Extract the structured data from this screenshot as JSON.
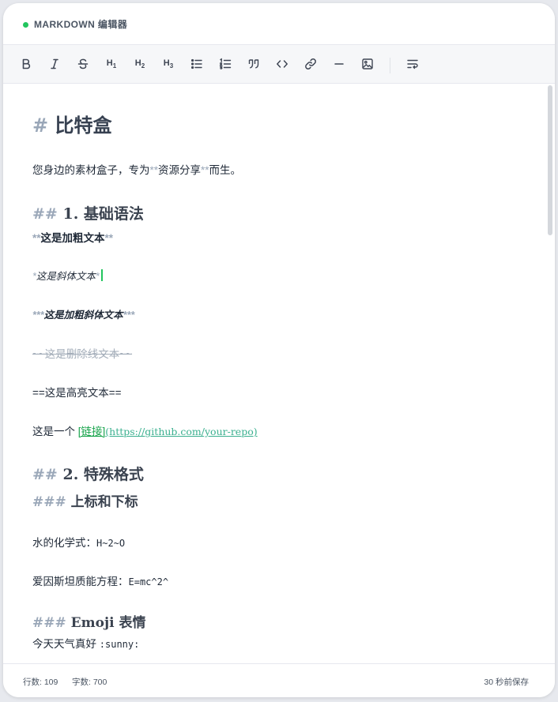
{
  "header": {
    "title": "MARKDOWN 编辑器",
    "status_color": "#22c55e"
  },
  "toolbar": {
    "buttons": [
      {
        "name": "bold",
        "icon": "bold-icon",
        "label": "B"
      },
      {
        "name": "italic",
        "icon": "italic-icon",
        "label": "I"
      },
      {
        "name": "strikethrough",
        "icon": "strikethrough-icon",
        "label": "S"
      },
      {
        "name": "heading-1",
        "icon": "heading-1-icon",
        "label": "H1"
      },
      {
        "name": "heading-2",
        "icon": "heading-2-icon",
        "label": "H2"
      },
      {
        "name": "heading-3",
        "icon": "heading-3-icon",
        "label": "H3"
      },
      {
        "name": "unordered-list",
        "icon": "unordered-list-icon"
      },
      {
        "name": "ordered-list",
        "icon": "ordered-list-icon"
      },
      {
        "name": "quote",
        "icon": "quote-icon"
      },
      {
        "name": "code",
        "icon": "code-icon"
      },
      {
        "name": "link",
        "icon": "link-icon"
      },
      {
        "name": "horizontal-rule",
        "icon": "horizontal-rule-icon"
      },
      {
        "name": "image",
        "icon": "image-icon"
      },
      {
        "name": "wrap",
        "icon": "text-wrap-icon"
      }
    ]
  },
  "editor": {
    "h1": {
      "marker": "#",
      "text": "比特盒"
    },
    "intro": {
      "before": "您身边的素材盒子，专为",
      "marker_open": "**",
      "bold": "资源分享",
      "marker_close": "**",
      "after": "而生。"
    },
    "sec1": {
      "marker": "##",
      "text": "1. 基础语法"
    },
    "bold_line": {
      "marker_open": "**",
      "text": "这是加粗文本",
      "marker_close": "**"
    },
    "italic_line": {
      "marker_open": "*",
      "text": "这是斜体文本",
      "marker_close": "*"
    },
    "bold_italic_line": {
      "marker_open": "***",
      "text": "这是加粗斜体文本",
      "marker_close": "***"
    },
    "strike_line": {
      "text": "~~这是删除线文本~~"
    },
    "highlight_line": {
      "text": "==这是高亮文本=="
    },
    "link_line": {
      "before": "这是一个 ",
      "link_text": "[链接]",
      "link_url": "(https://github.com/your-repo)"
    },
    "sec2": {
      "marker": "##",
      "text": "2. 特殊格式"
    },
    "sub1": {
      "marker": "###",
      "text": "上标和下标"
    },
    "water": {
      "label": "水的化学式：",
      "formula": "H~2~O"
    },
    "einstein": {
      "label": "爱因斯坦质能方程：",
      "formula": "E=mc^2^"
    },
    "sub2": {
      "marker": "###",
      "text": "Emoji 表情"
    },
    "emoji": {
      "label": "今天天气真好 ",
      "code": ":sunny:"
    }
  },
  "footer": {
    "lines": "行数: 109",
    "chars": "字数: 700",
    "save": "30 秒前保存"
  }
}
